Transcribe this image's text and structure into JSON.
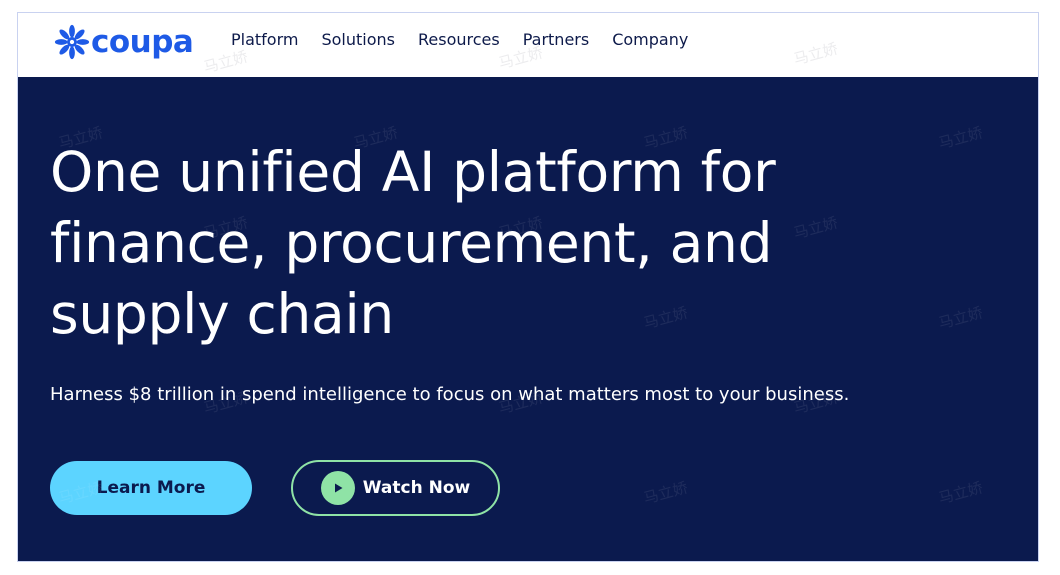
{
  "brand": {
    "name": "coupa",
    "color": "#1e5ae6"
  },
  "nav": {
    "items": [
      {
        "label": "Platform"
      },
      {
        "label": "Solutions"
      },
      {
        "label": "Resources"
      },
      {
        "label": "Partners"
      },
      {
        "label": "Company"
      }
    ]
  },
  "hero": {
    "headline": "One unified AI platform for finance, procurement, and supply chain",
    "subhead": "Harness $8 trillion in spend intelligence to focus on what matters most to your business.",
    "background_color": "#0b1a4e",
    "primary_button": {
      "label": "Learn More",
      "color": "#5cd4ff"
    },
    "secondary_button": {
      "label": "Watch Now",
      "icon": "play-icon",
      "accent": "#8fe3a6"
    }
  },
  "watermark": {
    "text": "马立娇"
  }
}
